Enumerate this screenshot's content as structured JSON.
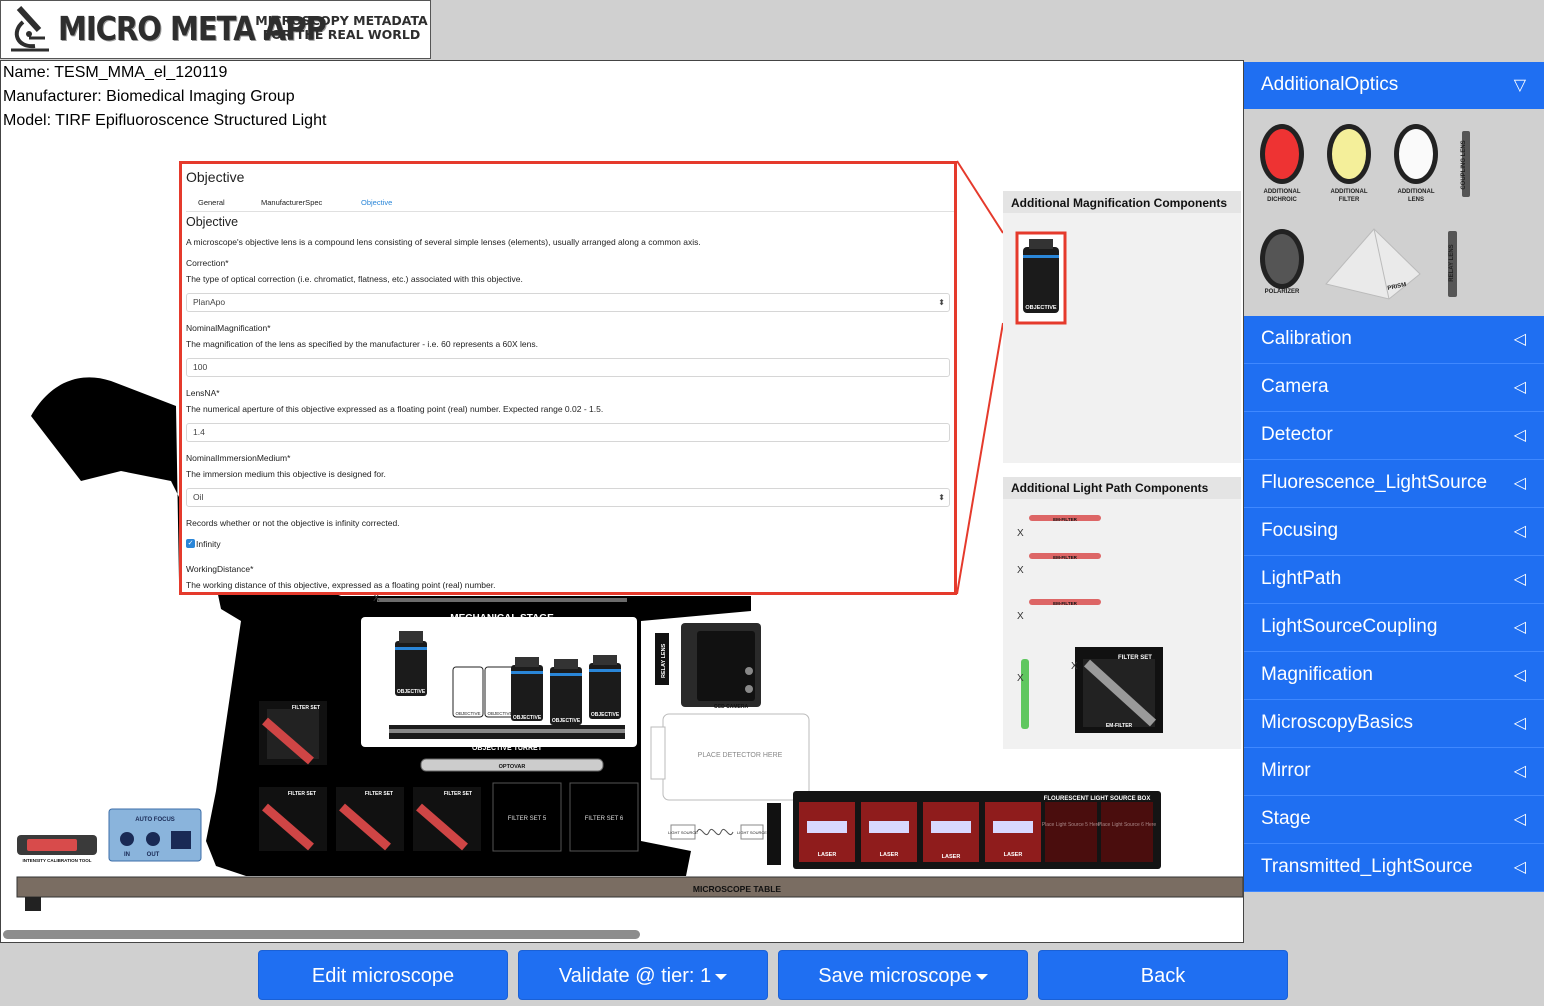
{
  "header": {
    "logo_title": "MICRO META APP",
    "logo_tagline_1": "MICROSCOPY METADATA",
    "logo_tagline_2": "FOR THE REAL WORLD"
  },
  "microscope": {
    "name_line": "Name: TESM_MMA_el_120119",
    "manufacturer_line": "Manufacturer: Biomedical Imaging Group",
    "model_line": "Model: TIRF Epifluoroscence Structured Light"
  },
  "editor": {
    "header": "Objective",
    "tabs": [
      "General",
      "ManufacturerSpec",
      "Objective"
    ],
    "active_tab": "Objective",
    "section_title": "Objective",
    "description": "A microscope's objective lens is a compound lens consisting of several simple lenses (elements), usually arranged along a common axis.",
    "correction_label": "Correction*",
    "correction_desc": "The type of optical correction (i.e. chromatict, flatness, etc.) associated with this objective.",
    "correction_value": "PlanApo",
    "magnification_label": "NominalMagnification*",
    "magnification_desc": "The magnification of the lens as specified by the manufacturer - i.e. 60 represents a 60X lens.",
    "magnification_value": "100",
    "lensna_label": "LensNA*",
    "lensna_desc": "The numerical aperture of this objective expressed as a floating point (real) number. Expected range 0.02 - 1.5.",
    "lensna_value": "1.4",
    "immersion_label": "NominalImmersionMedium*",
    "immersion_desc": "The immersion medium this objective is designed for.",
    "immersion_value": "Oil",
    "infinity_desc": "Records whether or not the objective is infinity corrected.",
    "infinity_label": "Infinity",
    "infinity_checked": true,
    "working_label": "WorkingDistance*",
    "working_desc": "The working distance of this objective, expressed as a floating point (real) number."
  },
  "panels": {
    "magnification_title": "Additional Magnification Components",
    "lightpath_title": "Additional Light Path Components",
    "objective_label": "OBJECTIVE",
    "em_filter": "EM-FILTER",
    "ex_filter": "EX-FILTER",
    "filter_set": "FILTER SET",
    "dichroic": "DICHROIC"
  },
  "scene": {
    "mechanical_stage": "MECHANICAL STAGE",
    "objective_turret": "OBJECTIVE TURRET",
    "optovar": "OPTOVAR",
    "relay_lens": "RELAY LENS",
    "ccd_camera": "CCD CAMERA",
    "place_detector": "PLACE DETECTOR HERE",
    "objective": "OBJECTIVE",
    "filter_set": "FILTER SET",
    "dichroic": "DICHROIC",
    "em_filter": "EM-FILTER",
    "ex_filter": "EX-FILTER",
    "filter_set_5": "FILTER SET 5",
    "filter_set_6": "FILTER SET 6",
    "auto_focus": "AUTO FOCUS",
    "in": "IN",
    "out": "OUT",
    "intensity_tool": "INTENSITY CALIBRATION TOOL",
    "light_source": "LIGHT SOURCE",
    "coupling_lens": "COUPLING LENS",
    "light_source_box": "FLOURESCENT LIGHT SOURCE BOX",
    "flourescence_light_source": "FLOURESCENCE LIGHT SOURCE",
    "laser": "LASER",
    "place_light_source_5": "Place Light Source 5 Here",
    "place_light_source_6": "Place Light Source 6 Here",
    "microscope_table": "MICROSCOPE TABLE",
    "close_x": "X"
  },
  "sidebar": {
    "open_category": "AdditionalOptics",
    "optics_items": [
      {
        "label_1": "ADDITIONAL",
        "label_2": "DICHROIC"
      },
      {
        "label_1": "ADDITIONAL",
        "label_2": "FILTER"
      },
      {
        "label_1": "ADDITIONAL",
        "label_2": "LENS"
      },
      {
        "label_1": "COUPLING LENS",
        "label_2": ""
      },
      {
        "label_1": "POLARIZER",
        "label_2": ""
      },
      {
        "label_1": "PRISM",
        "label_2": ""
      },
      {
        "label_1": "RELAY LENS",
        "label_2": ""
      }
    ],
    "categories": [
      "Calibration",
      "Camera",
      "Detector",
      "Fluorescence_LightSource",
      "Focusing",
      "LightPath",
      "LightSourceCoupling",
      "Magnification",
      "MicroscopyBasics",
      "Mirror",
      "Stage",
      "Transmitted_LightSource"
    ],
    "open_arrow": "▽",
    "closed_arrow": "◁"
  },
  "buttons": {
    "edit": "Edit microscope",
    "validate": "Validate @ tier: 1",
    "save": "Save microscope",
    "back": "Back"
  },
  "colors": {
    "accent": "#1f6ff2",
    "highlight": "#e53a2c",
    "background": "#d0d0d0"
  }
}
